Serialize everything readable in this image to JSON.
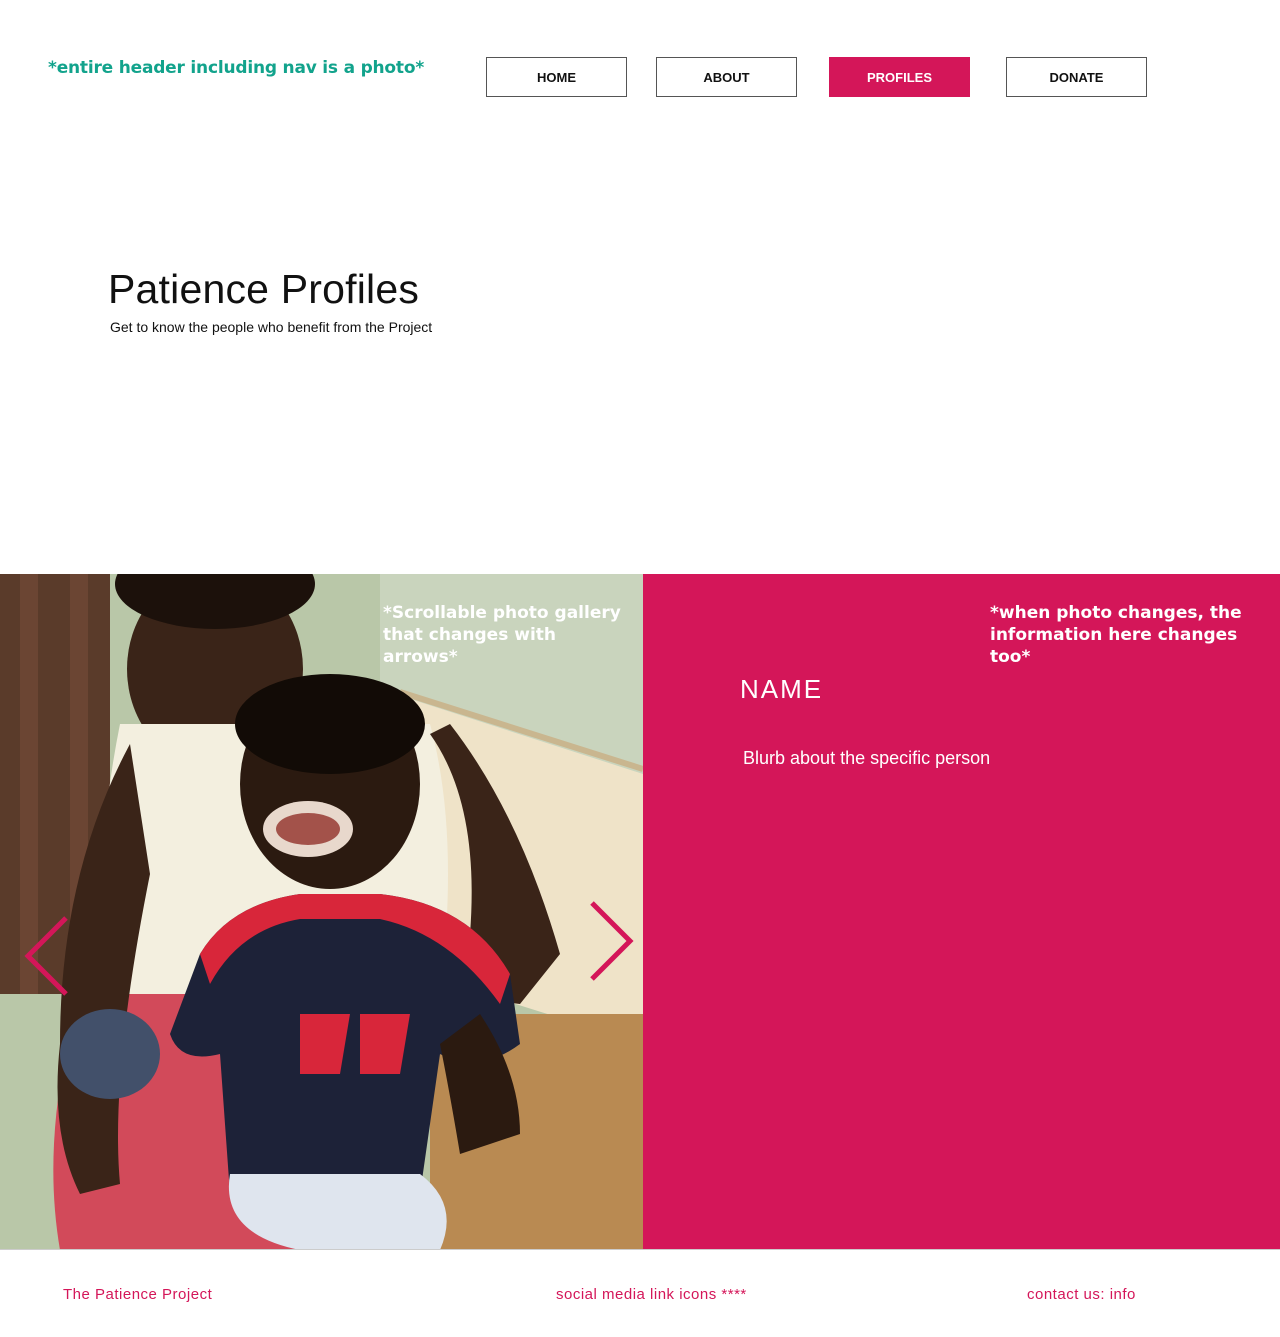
{
  "header": {
    "note": "*entire header including nav is a photo*",
    "nav": {
      "home": "HOME",
      "about": "ABOUT",
      "profiles": "PROFILES",
      "donate": "DONATE"
    },
    "active_color": "#d41659"
  },
  "hero": {
    "title": "Patience Profiles",
    "subtitle": "Get to know the people who benefit from the Project"
  },
  "gallery": {
    "note": "*Scrollable photo gallery that changes with arrows*",
    "prev_icon": "chevron-left-icon",
    "next_icon": "chevron-right-icon",
    "photo": "woman-and-smiling-boy-photo"
  },
  "profile": {
    "note": "*when photo changes, the information here changes too*",
    "name": "NAME",
    "blurb": "Blurb about the specific person",
    "panel_color": "#d41659"
  },
  "footer": {
    "brand": "The Patience Project",
    "social": "social media link icons ****",
    "contact": "contact us: info"
  }
}
